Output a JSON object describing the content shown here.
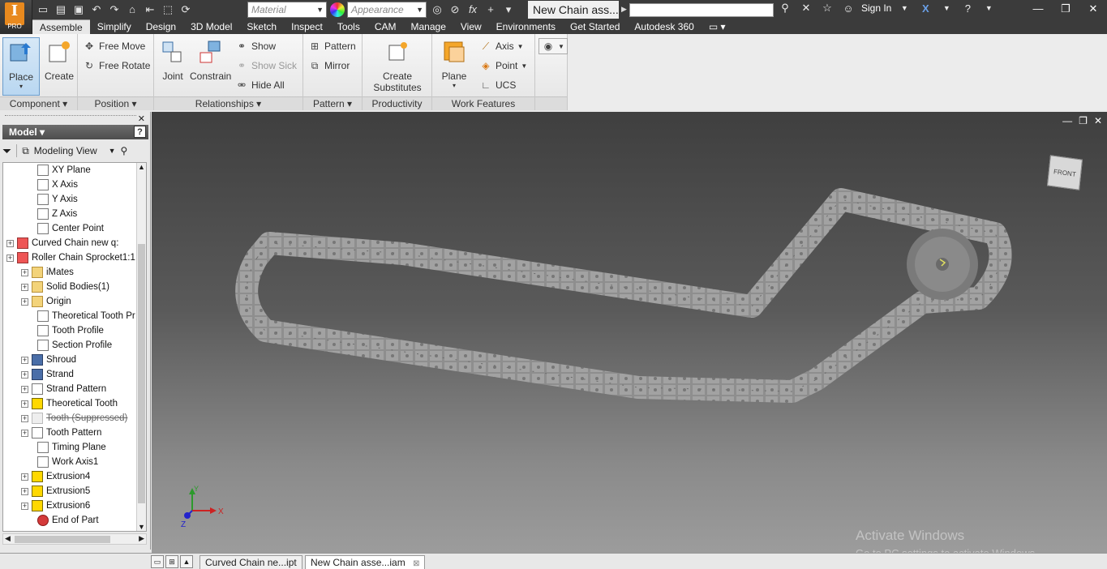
{
  "window": {
    "doc_title": "New Chain ass...",
    "app_badge": "PRO",
    "app_letter": "I",
    "signin": "Sign In"
  },
  "qat": {
    "material_placeholder": "Material",
    "appearance_placeholder": "Appearance"
  },
  "tabs": [
    "Assemble",
    "Simplify",
    "Design",
    "3D Model",
    "Sketch",
    "Inspect",
    "Tools",
    "CAM",
    "Manage",
    "View",
    "Environments",
    "Get Started",
    "Autodesk 360"
  ],
  "active_tab": "Assemble",
  "ribbon": {
    "component": {
      "label": "Component",
      "place": "Place",
      "create": "Create"
    },
    "position": {
      "label": "Position",
      "free_move": "Free Move",
      "free_rotate": "Free Rotate"
    },
    "relationships": {
      "label": "Relationships",
      "joint": "Joint",
      "constrain": "Constrain",
      "show": "Show",
      "show_sick": "Show Sick",
      "hide_all": "Hide All"
    },
    "pattern": {
      "label": "Pattern",
      "pattern": "Pattern",
      "mirror": "Mirror"
    },
    "productivity": {
      "label": "Productivity",
      "create_substitutes_1": "Create",
      "create_substitutes_2": "Substitutes"
    },
    "work_features": {
      "label": "Work Features",
      "plane": "Plane",
      "axis": "Axis",
      "point": "Point",
      "ucs": "UCS"
    }
  },
  "browser": {
    "title": "Model",
    "view": "Modeling View",
    "items": [
      {
        "label": "XY Plane",
        "icon": "plane-icon",
        "indent": 2,
        "expander": false
      },
      {
        "label": "X Axis",
        "icon": "axis-icon",
        "indent": 2,
        "expander": false
      },
      {
        "label": "Y Axis",
        "icon": "axis-icon",
        "indent": 2,
        "expander": false
      },
      {
        "label": "Z Axis",
        "icon": "axis-icon",
        "indent": 2,
        "expander": false
      },
      {
        "label": "Center Point",
        "icon": "point-icon",
        "indent": 2,
        "expander": false
      },
      {
        "label": "Curved Chain new q:",
        "icon": "part-icon",
        "indent": 0,
        "expander": true
      },
      {
        "label": "Roller Chain Sprocket1:1",
        "icon": "part-icon",
        "indent": 0,
        "expander": true
      },
      {
        "label": "iMates",
        "icon": "folder-icon",
        "indent": 1,
        "expander": true
      },
      {
        "label": "Solid Bodies(1)",
        "icon": "folder-icon",
        "indent": 1,
        "expander": true
      },
      {
        "label": "Origin",
        "icon": "folder-icon",
        "indent": 1,
        "expander": true
      },
      {
        "label": "Theoretical Tooth Pr",
        "icon": "sketch-icon",
        "indent": 2,
        "expander": false
      },
      {
        "label": "Tooth Profile",
        "icon": "sketch-icon",
        "indent": 2,
        "expander": false
      },
      {
        "label": "Section Profile",
        "icon": "sketch-icon",
        "indent": 2,
        "expander": false
      },
      {
        "label": "Shroud",
        "icon": "feature-icon",
        "indent": 1,
        "expander": true
      },
      {
        "label": "Strand",
        "icon": "feature-icon",
        "indent": 1,
        "expander": true
      },
      {
        "label": "Strand Pattern",
        "icon": "pattern-icon",
        "indent": 1,
        "expander": true
      },
      {
        "label": "Theoretical Tooth",
        "icon": "extrude-icon",
        "indent": 1,
        "expander": true
      },
      {
        "label": "Tooth (Suppressed)",
        "icon": "extrude-icon",
        "indent": 1,
        "expander": true,
        "suppressed": true
      },
      {
        "label": "Tooth Pattern",
        "icon": "pattern-icon",
        "indent": 1,
        "expander": true
      },
      {
        "label": "Timing Plane",
        "icon": "plane-icon",
        "indent": 2,
        "expander": false
      },
      {
        "label": "Work Axis1",
        "icon": "axis-icon",
        "indent": 2,
        "expander": false
      },
      {
        "label": "Extrusion4",
        "icon": "extrude-icon",
        "indent": 1,
        "expander": true
      },
      {
        "label": "Extrusion5",
        "icon": "extrude-icon",
        "indent": 1,
        "expander": true
      },
      {
        "label": "Extrusion6",
        "icon": "extrude-icon",
        "indent": 1,
        "expander": true
      },
      {
        "label": "End of Part",
        "icon": "end-icon",
        "indent": 2,
        "expander": false
      }
    ]
  },
  "viewport": {
    "viewcube_face": "FRONT",
    "axis_x": "X",
    "axis_y": "Y",
    "axis_z": "Z",
    "activate_title": "Activate Windows",
    "activate_sub": "Go to PC settings to activate Windows."
  },
  "doc_tabs": [
    {
      "label": "Curved Chain ne...ipt",
      "active": false
    },
    {
      "label": "New Chain asse...iam",
      "active": true
    }
  ]
}
